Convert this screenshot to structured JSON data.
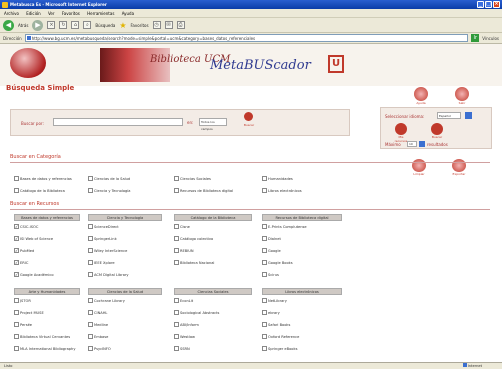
{
  "window": {
    "title": "Metabusca Es - Microsoft Internet Explorer",
    "minimize": "_",
    "maximize": "□",
    "close": "×"
  },
  "menu": [
    "Archivo",
    "Edición",
    "Ver",
    "Favoritos",
    "Herramientas",
    "Ayuda"
  ],
  "toolbar": {
    "back_label": "Atrás",
    "search_label": "Búsqueda",
    "favorites_label": "Favoritos"
  },
  "address": {
    "label": "Dirección",
    "url": "http://www.bg.ucm.es/metabusqueda/search?mode=simple&portal=ucm&category=bases_datos_referenciales",
    "go": "Ir",
    "links_label": "Vínculos"
  },
  "banner": {
    "sub": "Biblioteca UCM",
    "title": "MetaBUScador",
    "logo": "U"
  },
  "page_title": "Búsqueda Simple",
  "header_icons": [
    {
      "label": "Ayuda"
    },
    {
      "label": "Salir"
    }
  ],
  "search": {
    "label": "Buscar por:",
    "placeholder": "",
    "in_label": "en:",
    "field_value": "Todos los campos",
    "button_label": "Buscar"
  },
  "right_panel": {
    "lang_label": "Seleccionar idioma:",
    "lang_value": "Español",
    "icons": [
      {
        "label": "Mis recursos"
      },
      {
        "label": "Buscar"
      }
    ],
    "max_label": "Máximo",
    "max_value": "10",
    "results_label": "resultados"
  },
  "actions": [
    {
      "label": "Limpiar"
    },
    {
      "label": "Exportar"
    }
  ],
  "categories_title": "Buscar en Categoría",
  "categories": [
    "Bases de datos y referencias",
    "Ciencias de la Salud",
    "Ciencias Sociales",
    "Humanidades",
    "Catálogo de la Biblioteca",
    "Ciencia y Tecnología",
    "Recursos de Biblioteca digital",
    "Libros electrónicos"
  ],
  "resources_title": "Buscar en Recursos",
  "groups": [
    {
      "header": "Bases de datos y referencias",
      "items": [
        {
          "label": "CSIC-ISOC",
          "checked": true
        },
        {
          "label": "ISI Web of Science",
          "checked": true
        },
        {
          "label": "PubMed",
          "checked": true
        },
        {
          "label": "ERIC",
          "checked": true
        },
        {
          "label": "Google Académico",
          "checked": true
        }
      ]
    },
    {
      "header": "Ciencia y Tecnología",
      "items": [
        {
          "label": "ScienceDirect",
          "checked": false
        },
        {
          "label": "SpringerLink",
          "checked": false
        },
        {
          "label": "Wiley InterScience",
          "checked": false
        },
        {
          "label": "IEEE Xplore",
          "checked": false
        },
        {
          "label": "ACM Digital Library",
          "checked": false
        }
      ]
    },
    {
      "header": "Catálogo de la Biblioteca",
      "items": [
        {
          "label": "Cisne",
          "checked": false
        },
        {
          "label": "Catálogo colectivo",
          "checked": false
        },
        {
          "label": "REBIUN",
          "checked": false
        },
        {
          "label": "Biblioteca Nacional",
          "checked": false
        }
      ]
    },
    {
      "header": "Recursos de Biblioteca digital",
      "items": [
        {
          "label": "E-Prints Complutense",
          "checked": false
        },
        {
          "label": "Dialnet",
          "checked": false
        },
        {
          "label": "Google",
          "checked": false
        },
        {
          "label": "Google Books",
          "checked": false
        },
        {
          "label": "Scirus",
          "checked": false
        }
      ]
    },
    {
      "header": "Arte y Humanidades",
      "items": [
        {
          "label": "JSTOR",
          "checked": false
        },
        {
          "label": "Project MUSE",
          "checked": false
        },
        {
          "label": "Persée",
          "checked": false
        },
        {
          "label": "Biblioteca Virtual Cervantes",
          "checked": false
        },
        {
          "label": "MLA International Bibliography",
          "checked": false
        }
      ]
    },
    {
      "header": "Ciencias de la Salud",
      "items": [
        {
          "label": "Cochrane Library",
          "checked": false
        },
        {
          "label": "CINAHL",
          "checked": false
        },
        {
          "label": "Medline",
          "checked": false
        },
        {
          "label": "Embase",
          "checked": false
        },
        {
          "label": "PsycINFO",
          "checked": false
        }
      ]
    },
    {
      "header": "Ciencias Sociales",
      "items": [
        {
          "label": "EconLit",
          "checked": false
        },
        {
          "label": "Sociological Abstracts",
          "checked": false
        },
        {
          "label": "ABI/Inform",
          "checked": false
        },
        {
          "label": "Westlaw",
          "checked": false
        },
        {
          "label": "SSRN",
          "checked": false
        }
      ]
    },
    {
      "header": "Libros electrónicos",
      "items": [
        {
          "label": "NetLibrary",
          "checked": false
        },
        {
          "label": "ebrary",
          "checked": false
        },
        {
          "label": "Safari Books",
          "checked": false
        },
        {
          "label": "Oxford Reference",
          "checked": false
        },
        {
          "label": "Springer eBooks",
          "checked": false
        }
      ]
    }
  ],
  "status": {
    "text": "Listo",
    "zone": "Internet"
  },
  "colors": {
    "accent": "#c0392b",
    "title_blue": "#2f3a90",
    "window_blue": "#0b3ca8"
  }
}
